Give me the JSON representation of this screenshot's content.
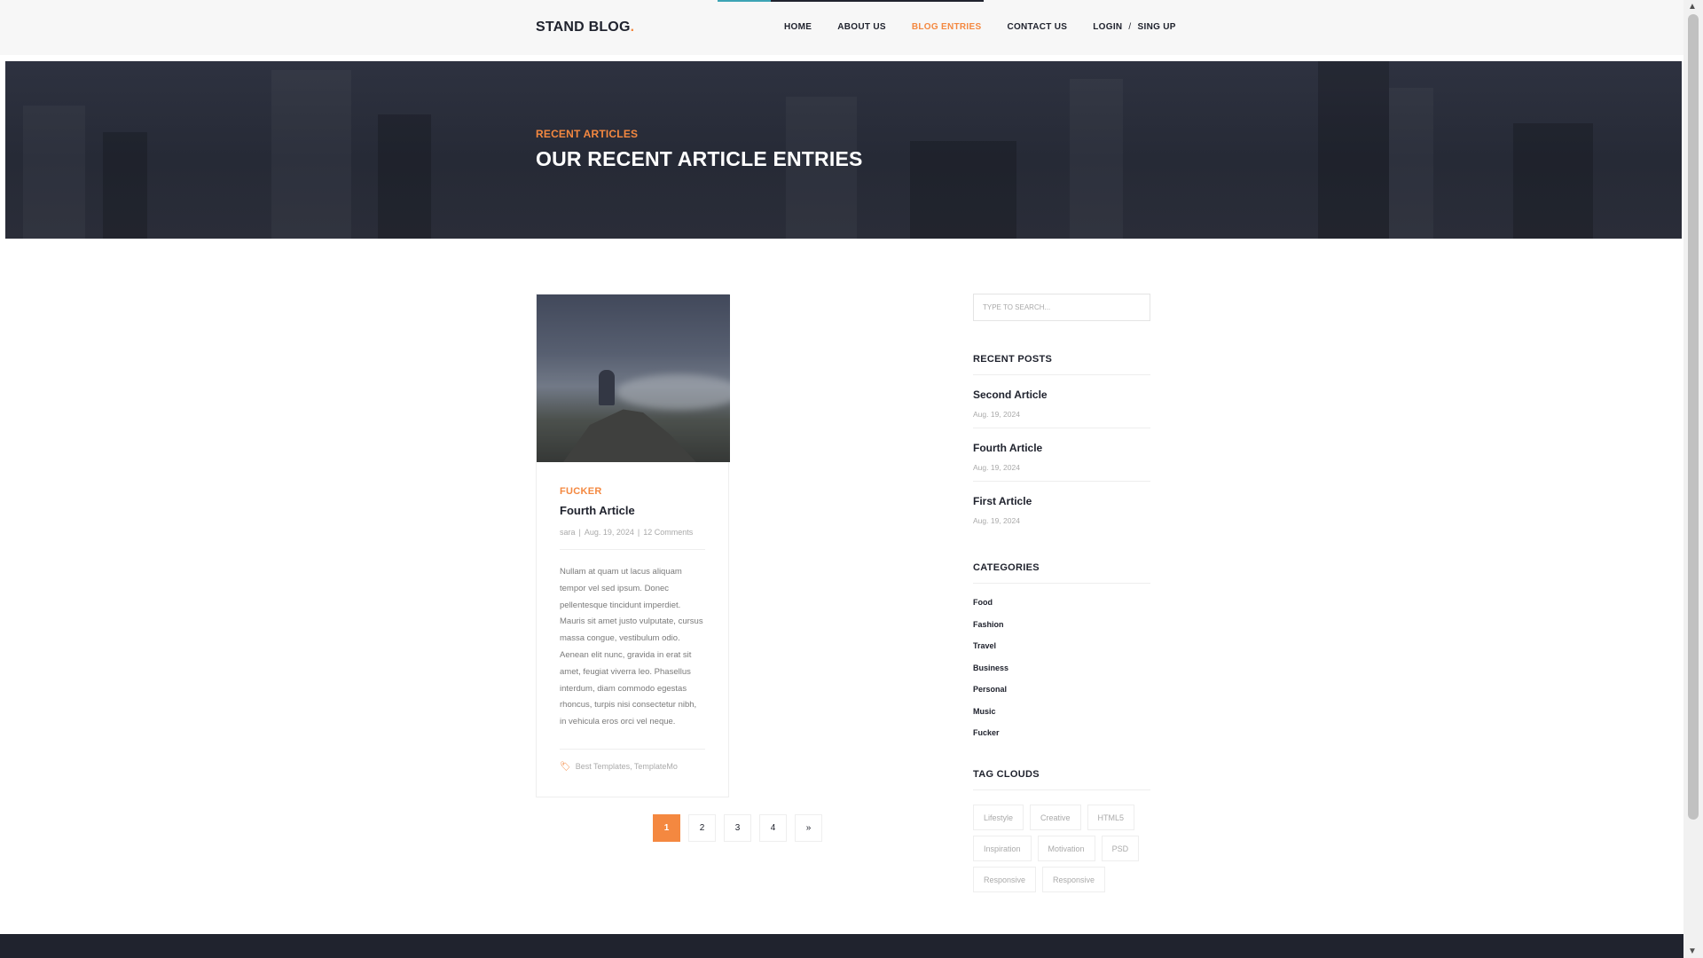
{
  "header": {
    "logo_text": "STAND BLOG",
    "logo_dot": ".",
    "nav": {
      "home": "HOME",
      "about": "ABOUT US",
      "blog": "BLOG ENTRIES",
      "contact": "CONTACT US",
      "login": "LOGIN",
      "separator": "/",
      "signup": "SING UP"
    }
  },
  "hero": {
    "subtitle": "RECENT ARTICLES",
    "title": "OUR RECENT ARTICLE ENTRIES"
  },
  "article": {
    "category": "FUCKER",
    "title": "Fourth Article",
    "author": "sara",
    "date": "Aug. 19, 2024",
    "comments": "12 Comments",
    "meta_separator": "|",
    "body": "Nullam at quam ut lacus aliquam tempor vel sed ipsum. Donec pellentesque tincidunt imperdiet. Mauris sit amet justo vulputate, cursus massa congue, vestibulum odio. Aenean elit nunc, gravida in erat sit amet, feugiat viverra leo. Phasellus interdum, diam commodo egestas rhoncus, turpis nisi consectetur nibh, in vehicula eros orci vel neque.",
    "tags_text": "Best Templates, TemplateMo",
    "tag_icon": "tags-icon"
  },
  "pagination": {
    "pages": [
      "1",
      "2",
      "3",
      "4"
    ],
    "next": "»",
    "current": "1"
  },
  "sidebar": {
    "search_placeholder": "TYPE TO SEARCH...",
    "recent_heading": "RECENT POSTS",
    "recent_posts": [
      {
        "title": "Second Article",
        "date": "Aug. 19, 2024"
      },
      {
        "title": "Fourth Article",
        "date": "Aug. 19, 2024"
      },
      {
        "title": "First Article",
        "date": "Aug. 19, 2024"
      }
    ],
    "categories_heading": "CATEGORIES",
    "categories": [
      "Food",
      "Fashion",
      "Travel",
      "Business",
      "Personal",
      "Music",
      "Fucker"
    ],
    "tags_heading": "TAG CLOUDS",
    "tags": [
      "Lifestyle",
      "Creative",
      "HTML5",
      "Inspiration",
      "Motivation",
      "PSD",
      "Responsive",
      "Responsive"
    ]
  },
  "colors": {
    "accent": "#f48840",
    "dark": "#20232e",
    "hero_bg": "#2a2d38"
  }
}
